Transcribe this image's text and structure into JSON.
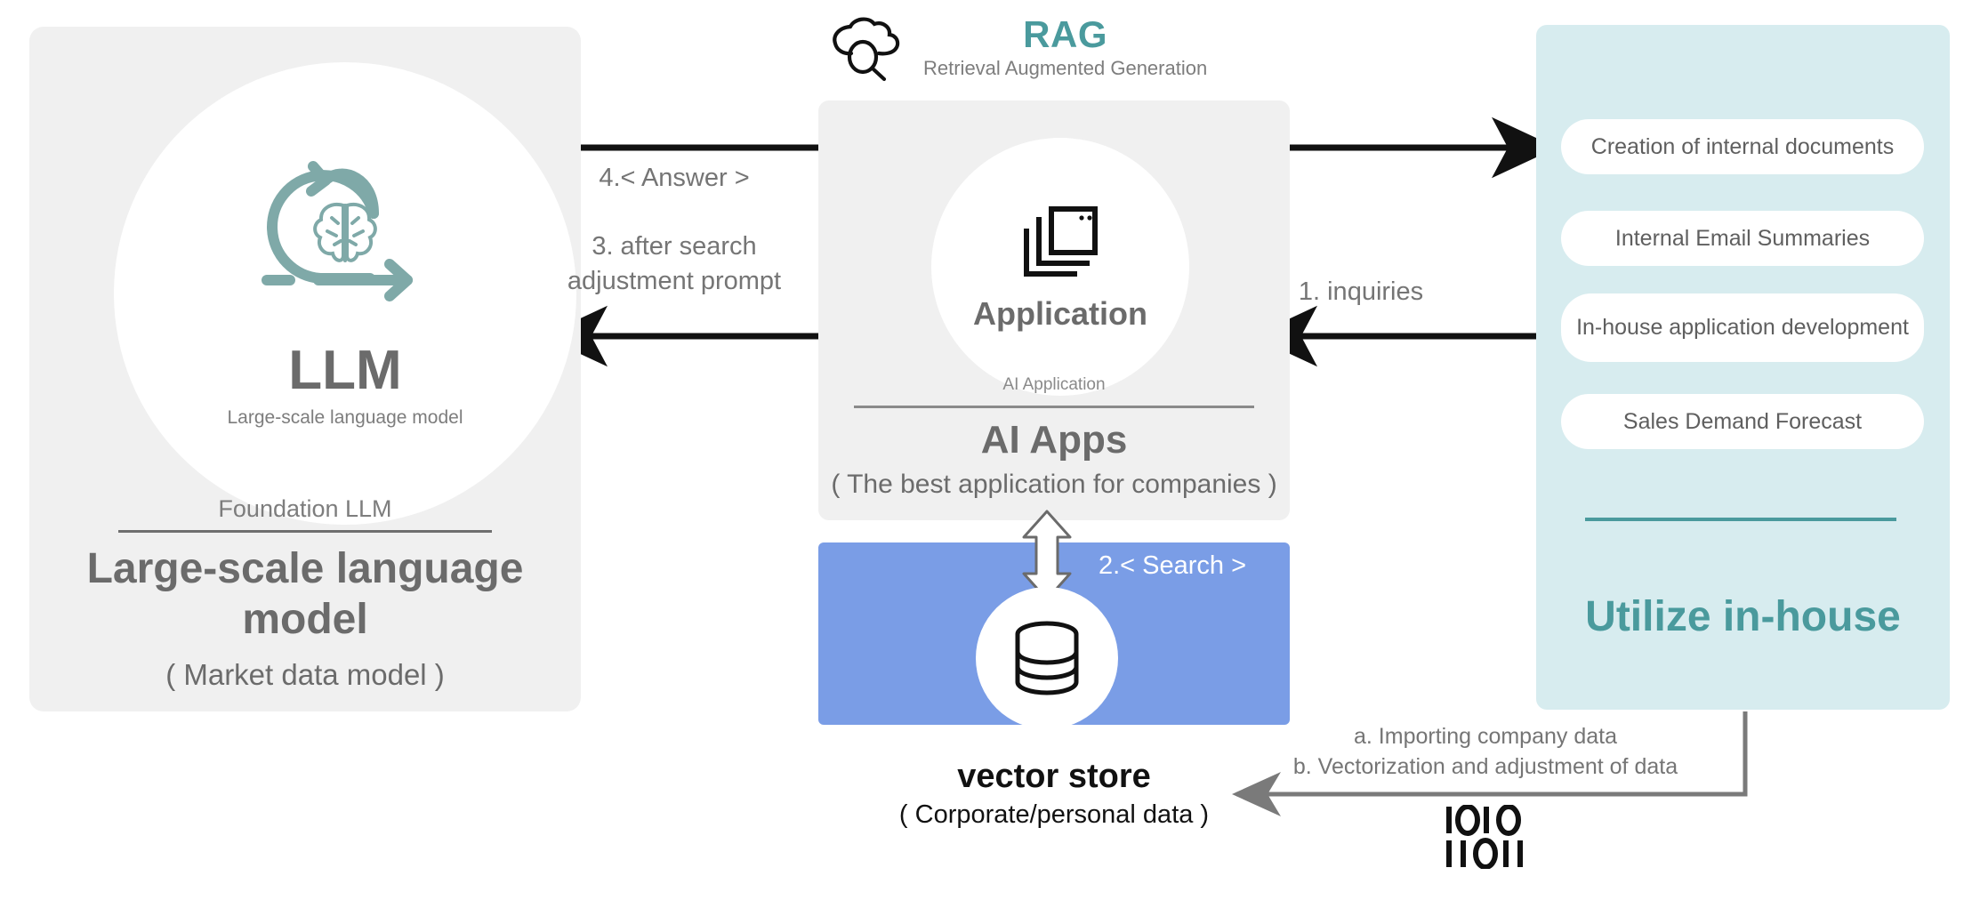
{
  "header": {
    "icon": "cloud-search-icon",
    "title": "RAG",
    "subtitle": "Retrieval Augmented Generation",
    "accent_color": "#4a9a9d"
  },
  "llm_panel": {
    "icon": "brain-loop-icon",
    "circle_title": "LLM",
    "circle_subtitle": "Large-scale language model",
    "kicker": "Foundation LLM",
    "title": "Large-scale language model",
    "subtitle": "( Market data model )",
    "background_color": "#f0f0f0"
  },
  "app_panel": {
    "icon": "stacked-windows-icon",
    "circle_label": "Application",
    "kicker": "AI Application",
    "title": "AI Apps",
    "subtitle": "( The best application for companies )",
    "background_color": "#f0f0f0"
  },
  "vector_store": {
    "icon": "database-cylinder-icon",
    "search_label": "2.< Search >",
    "title": "vector store",
    "subtitle": "( Corporate/personal data )",
    "box_color": "#7a9de6"
  },
  "inhouse_panel": {
    "background_color": "#d7ecef",
    "accent_color": "#4a9a9d",
    "chips": [
      {
        "label": "Creation of internal documents"
      },
      {
        "label": "Internal Email Summaries"
      },
      {
        "label": "In-house application development"
      },
      {
        "label": "Sales Demand Forecast"
      }
    ],
    "title": "Utilize in-house"
  },
  "flow": {
    "step1": "1. inquiries",
    "step2": "2.< Search >",
    "step3": "3. after search adjustment prompt",
    "step4": "4.< Answer >",
    "ingest_a": "a. Importing company data",
    "ingest_b": "b. Vectorization and adjustment of data",
    "binary_icon_top": "IOIO",
    "binary_icon_bottom": "IIOII"
  }
}
